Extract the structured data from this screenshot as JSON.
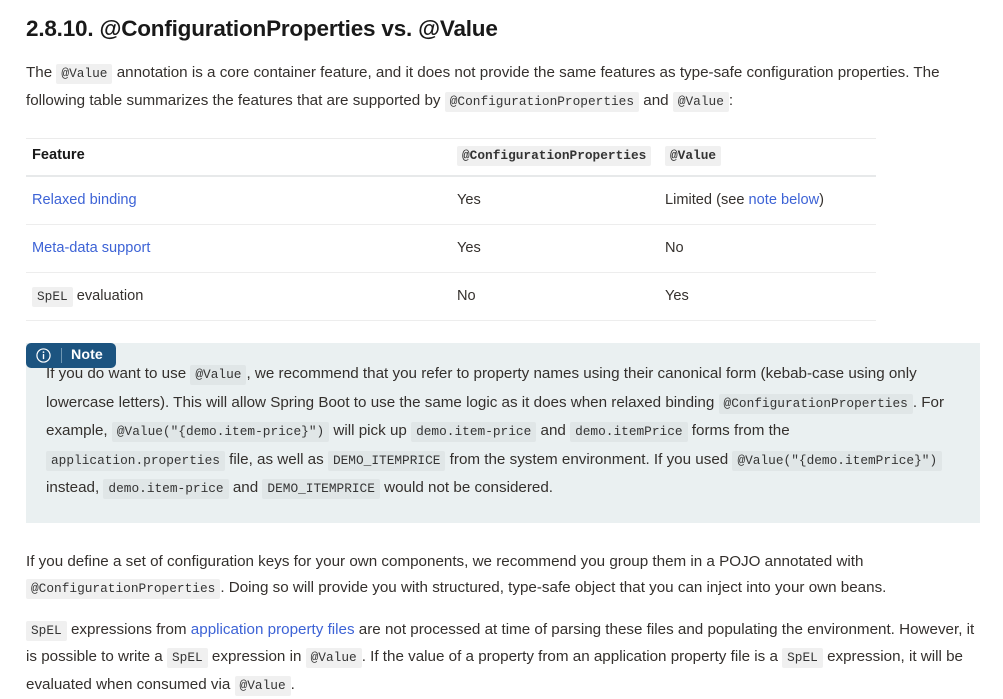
{
  "heading": "2.8.10. @ConfigurationProperties vs. @Value",
  "intro": {
    "part1": "The ",
    "code1": "@Value",
    "part2": " annotation is a core container feature, and it does not provide the same features as type-safe configuration properties. The following table summarizes the features that are supported by ",
    "code2": "@ConfigurationProperties",
    "part3": " and ",
    "code3": "@Value",
    "part4": ":"
  },
  "table": {
    "headers": {
      "feature": "Feature",
      "configuration_properties": "@ConfigurationProperties",
      "value": "@Value"
    },
    "rows": [
      {
        "feature_link": "Relaxed binding",
        "feature_is_link": true,
        "feature_code": "",
        "feature_text": "",
        "configuration_properties": "Yes",
        "value_prefix": "Limited (see ",
        "value_link": "note below",
        "value_suffix": ")"
      },
      {
        "feature_link": "Meta-data support",
        "feature_is_link": true,
        "feature_code": "",
        "feature_text": "",
        "configuration_properties": "Yes",
        "value_prefix": "No",
        "value_link": "",
        "value_suffix": ""
      },
      {
        "feature_link": "",
        "feature_is_link": false,
        "feature_code": "SpEL",
        "feature_text": " evaluation",
        "configuration_properties": "No",
        "value_prefix": "Yes",
        "value_link": "",
        "value_suffix": ""
      }
    ]
  },
  "note": {
    "badge_label": "Note",
    "icon": "info-circle-icon",
    "body": {
      "t1": "If you do want to use ",
      "c1": "@Value",
      "t2": ", we recommend that you refer to property names using their canonical form (kebab-case using only lowercase letters). This will allow Spring Boot to use the same logic as it does when relaxed binding ",
      "c2": "@ConfigurationProperties",
      "t3": ". For example, ",
      "c3": "@Value(\"{demo.item-price}\")",
      "t4": " will pick up ",
      "c4": "demo.item-price",
      "t5": " and ",
      "c5": "demo.itemPrice",
      "t6": " forms from the ",
      "c6": "application.properties",
      "t7": " file, as well as ",
      "c7": "DEMO_ITEMPRICE",
      "t8": " from the system environment. If you used ",
      "c8": "@Value(\"{demo.itemPrice}\")",
      "t9": " instead, ",
      "c9": "demo.item-price",
      "t10": " and ",
      "c10": "DEMO_ITEMPRICE",
      "t11": " would not be considered."
    }
  },
  "tail_paragraph_1": {
    "t1": "If you define a set of configuration keys for your own components, we recommend you group them in a POJO annotated with ",
    "c1": "@ConfigurationProperties",
    "t2": ". Doing so will provide you with structured, type-safe object that you can inject into your own beans."
  },
  "tail_paragraph_2": {
    "c1": "SpEL",
    "t1": " expressions from ",
    "link1": "application property files",
    "t2": " are not processed at time of parsing these files and populating the environment. However, it is possible to write a ",
    "c2": "SpEL",
    "t3": " expression in ",
    "c3": "@Value",
    "t4": ". If the value of a property from an application property file is a ",
    "c4": "SpEL",
    "t5": " expression, it will be evaluated when consumed via ",
    "c5": "@Value",
    "t6": "."
  },
  "colors": {
    "link": "#3d63d6",
    "note_badge_bg": "#1c5480",
    "note_body_bg": "#eaf0f1",
    "code_bg": "#f0f0f0",
    "text": "#34302d"
  }
}
